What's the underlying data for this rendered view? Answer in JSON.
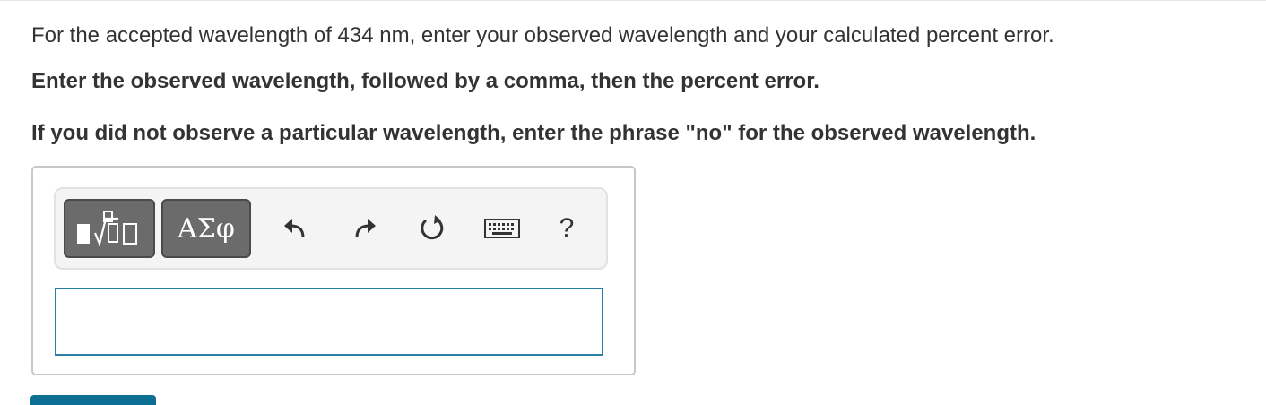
{
  "question": {
    "prompt": "For the accepted wavelength of 434 nm, enter your observed wavelength and your calculated percent error.",
    "instruction_format": "Enter the observed wavelength, followed by a comma, then the percent error.",
    "instruction_no": "If you did not observe a particular wavelength, enter the phrase \"no\" for the observed wavelength."
  },
  "toolbar": {
    "symbols_label": "ΑΣφ",
    "help_label": "?",
    "icons": [
      "templates-icon",
      "undo-icon",
      "redo-icon",
      "reset-icon",
      "keyboard-icon",
      "help-icon"
    ]
  },
  "answer": {
    "value": "",
    "placeholder": ""
  },
  "colors": {
    "tool_button_bg": "#6b6b6b",
    "input_border": "#2a7fa4",
    "submit_bg": "#0e6f94"
  }
}
